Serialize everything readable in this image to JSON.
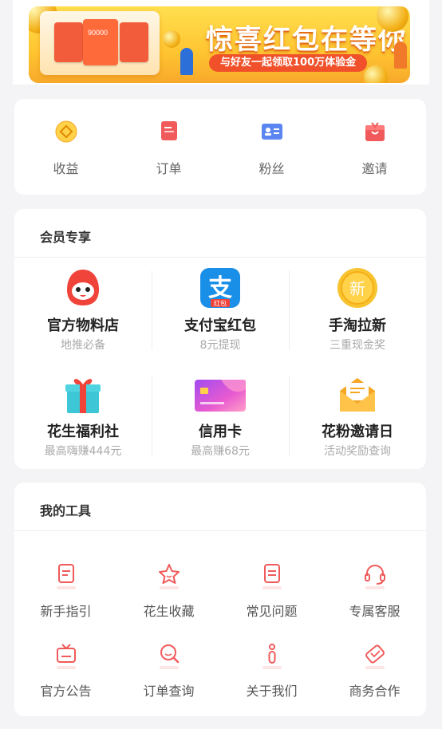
{
  "banner": {
    "headline": "惊喜红包在等你",
    "subline": "与好友一起领取100万体验金",
    "card_number": "90000"
  },
  "quick_actions": [
    {
      "label": "收益",
      "icon": "earnings-icon",
      "color": "#f5a623"
    },
    {
      "label": "订单",
      "icon": "order-icon",
      "color": "#f05a5a"
    },
    {
      "label": "粉丝",
      "icon": "fans-icon",
      "color": "#4a7cf0"
    },
    {
      "label": "邀请",
      "icon": "invite-icon",
      "color": "#f05a5a"
    }
  ],
  "member": {
    "title": "会员专享",
    "items": [
      {
        "name": "官方物料店",
        "sub": "地推必备",
        "icon": "mascot-icon"
      },
      {
        "name": "支付宝红包",
        "sub": "8元提现",
        "icon": "alipay-icon",
        "icon_text": "支",
        "badge": "红包"
      },
      {
        "name": "手淘拉新",
        "sub": "三重现金奖",
        "icon": "new-badge-icon",
        "icon_text": "新"
      },
      {
        "name": "花生福利社",
        "sub": "最高嗨赚444元",
        "icon": "gift-icon"
      },
      {
        "name": "信用卡",
        "sub": "最高赚68元",
        "icon": "credit-card-icon"
      },
      {
        "name": "花粉邀请日",
        "sub": "活动奖励查询",
        "icon": "envelope-icon"
      }
    ]
  },
  "tools": {
    "title": "我的工具",
    "items": [
      {
        "label": "新手指引",
        "icon": "guide-icon"
      },
      {
        "label": "花生收藏",
        "icon": "favorite-star-icon"
      },
      {
        "label": "常见问题",
        "icon": "faq-icon"
      },
      {
        "label": "专属客服",
        "icon": "headset-icon"
      },
      {
        "label": "官方公告",
        "icon": "tv-announcement-icon"
      },
      {
        "label": "订单查询",
        "icon": "search-order-icon"
      },
      {
        "label": "关于我们",
        "icon": "info-icon"
      },
      {
        "label": "商务合作",
        "icon": "handshake-icon"
      }
    ]
  },
  "colors": {
    "accent": "#f05a5a",
    "banner": "#ffc531"
  }
}
